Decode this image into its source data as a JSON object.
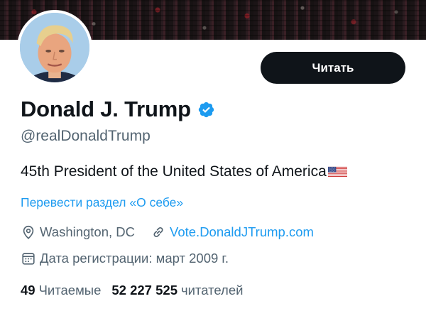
{
  "profile": {
    "display_name": "Donald J. Trump",
    "handle": "@realDonaldTrump",
    "bio": "45th President of the United States of America",
    "bio_emoji": "us-flag-emoji",
    "translate_bio_label": "Перевести раздел «О себе»",
    "location": "Washington, DC",
    "website": "Vote.DonaldJTrump.com",
    "joined": "Дата регистрации: март 2009 г.",
    "following_count": "49",
    "following_label": "Читаемые",
    "followers_count": "52 227 525",
    "followers_label": "читателей",
    "verified": true
  },
  "actions": {
    "follow_label": "Читать"
  },
  "icons": {
    "verified": "verified-badge-icon",
    "location": "location-pin-icon",
    "link": "link-icon",
    "calendar": "calendar-icon"
  },
  "colors": {
    "text_primary": "#0f1419",
    "text_secondary": "#536471",
    "link_blue": "#1d9bf0",
    "button_bg": "#0f1419",
    "button_text": "#ffffff"
  }
}
